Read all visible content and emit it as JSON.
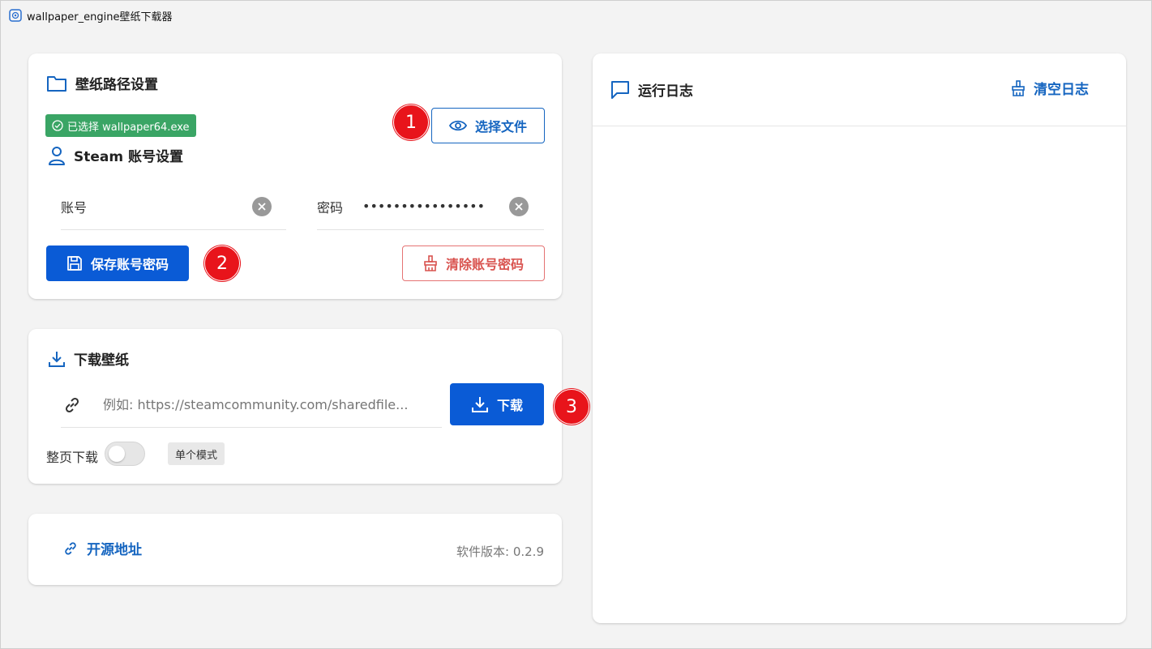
{
  "window": {
    "title": "wallpaper_engine壁纸下载器"
  },
  "path_card": {
    "title": "壁纸路径设置",
    "status_badge": "已选择 wallpaper64.exe",
    "choose_file_label": "选择文件",
    "marker": "1"
  },
  "account_card": {
    "title": "Steam 账号设置",
    "account_label": "账号",
    "account_value": "",
    "password_label": "密码",
    "password_value": "••••••••••••••••",
    "save_label": "保存账号密码",
    "clear_label": "清除账号密码",
    "marker": "2"
  },
  "download_card": {
    "title": "下载壁纸",
    "url_placeholder": "例如: https://steamcommunity.com/sharedfile...",
    "download_label": "下载",
    "page_download_label": "整页下载",
    "page_download_enabled": false,
    "mode_label": "单个模式",
    "marker": "3"
  },
  "footer_card": {
    "repo_label": "开源地址",
    "version_text": "软件版本: 0.2.9"
  },
  "log_panel": {
    "title": "运行日志",
    "clear_label": "清空日志"
  },
  "colors": {
    "primary": "#0a5bd6",
    "success": "#3aa565",
    "danger": "#d9534f",
    "marker": "#e8141b"
  }
}
